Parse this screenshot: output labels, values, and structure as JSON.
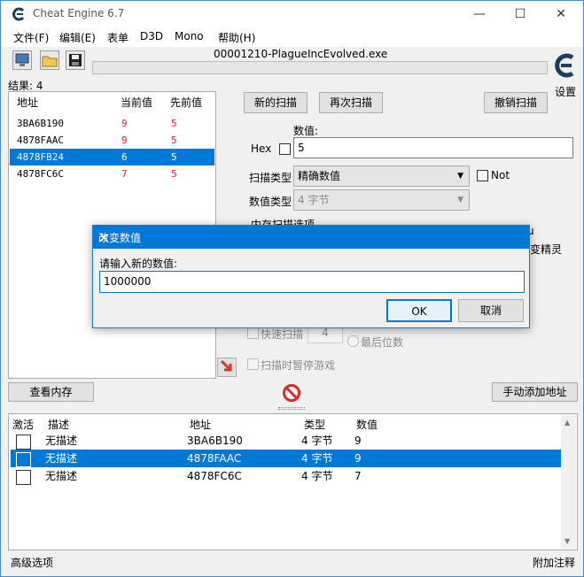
{
  "window": {
    "title": "Cheat Engine 6.7",
    "process": "00001210-PlagueIncEvolved.exe"
  },
  "menu": [
    "文件(F)",
    "编辑(E)",
    "表单",
    "D3D",
    "Mono",
    "帮助(H)"
  ],
  "settings_label": "设置",
  "results_label": "结果: 4",
  "found_list": {
    "headers": [
      "地址",
      "当前值",
      "先前值"
    ],
    "rows": [
      {
        "address": "3BA6B190",
        "current": "9",
        "previous": "5"
      },
      {
        "address": "4878FAAC",
        "current": "9",
        "previous": "5"
      },
      {
        "address": "4878FB24",
        "current": "6",
        "previous": "5"
      },
      {
        "address": "4878FC6C",
        "current": "7",
        "previous": "5"
      }
    ]
  },
  "scan": {
    "new_scan": "新的扫描",
    "next_scan": "再次扫描",
    "undo_scan": "撤销扫描",
    "value_label": "数值:",
    "hex_label": "Hex",
    "value": "5",
    "scan_type_label": "扫描类型",
    "scan_type": "精确数值",
    "not_label": "Not",
    "value_type_label": "数值类型",
    "value_type": "4 字节",
    "memory_options_label": "内存扫描选项",
    "partial_right_1": "u",
    "partial_right_2": "变精灵",
    "fast_scan_label": "快速扫描",
    "fast_scan_value": "4",
    "last_digits_label": "最后位数",
    "pause_game_label": "扫描时暂停游戏"
  },
  "view_memory": "查看内存",
  "add_address_manually": "手动添加地址",
  "cheat_table": {
    "headers": [
      "激活",
      "描述",
      "地址",
      "类型",
      "数值"
    ],
    "rows": [
      {
        "desc": "无描述",
        "address": "3BA6B190",
        "type": "4 字节",
        "value": "9"
      },
      {
        "desc": "无描述",
        "address": "4878FAAC",
        "type": "4 字节",
        "value": "9"
      },
      {
        "desc": "无描述",
        "address": "4878FC6C",
        "type": "4 字节",
        "value": "7"
      }
    ]
  },
  "status": {
    "advanced": "高级选项",
    "comments": "附加注释"
  },
  "dialog": {
    "title": "改变数值",
    "prompt": "请输入新的数值:",
    "value": "1000000",
    "ok": "OK",
    "cancel": "取消"
  },
  "colors": {
    "selection": "#0078d7",
    "value_red": "#e0262b",
    "dialog_title": "#0078d7"
  }
}
